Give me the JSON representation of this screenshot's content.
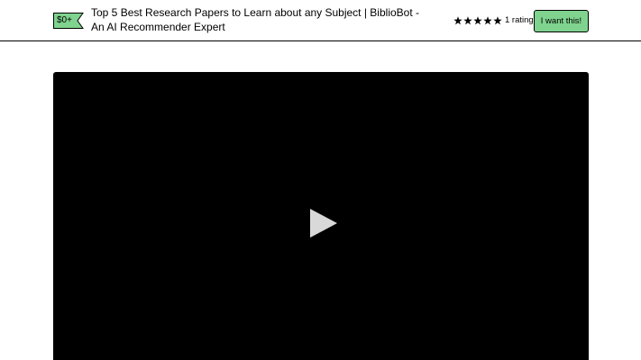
{
  "header": {
    "price": "$0+",
    "title": "Top 5 Best Research Papers to Learn about any Subject | BiblioBot - An AI Recommender Expert",
    "rating": {
      "stars": 5,
      "count_label": "1 rating"
    },
    "cta_label": "I want this!"
  },
  "video": {
    "play_icon": "play-icon"
  },
  "colors": {
    "accent_green": "#7fd38e",
    "video_bg": "#000000",
    "play_icon": "#d9d9d9"
  }
}
